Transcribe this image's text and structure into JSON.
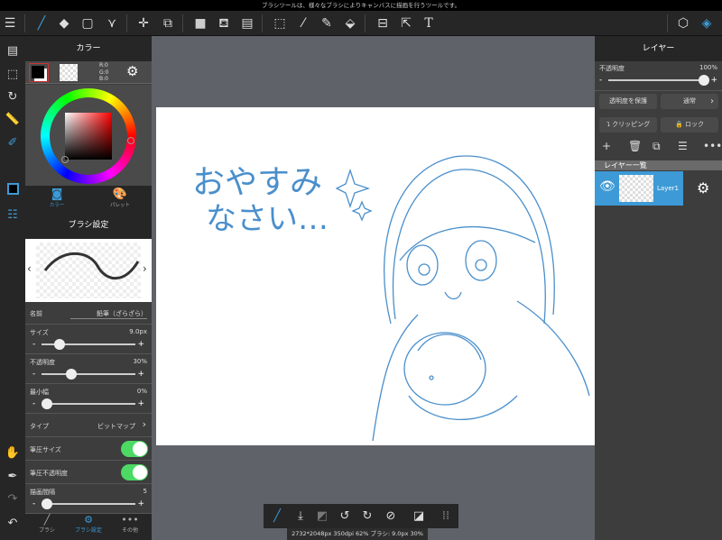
{
  "status_text": "ブラシツールは、様々なブラシによりキャンバスに描画を行うツールです。",
  "color_panel": {
    "title": "カラー",
    "r": "R:0",
    "g": "G:0",
    "b": "B:0",
    "tab_color": "カラー",
    "tab_palette": "パレット"
  },
  "brush_settings": {
    "title": "ブラシ設定",
    "name_label": "名前",
    "name_value": "鉛筆（ざらざら）",
    "size_label": "サイズ",
    "size_value": "9.0px",
    "size_fraction": 0.18,
    "opacity_label": "不透明度",
    "opacity_value": "30%",
    "opacity_fraction": 0.3,
    "min_width_label": "最小幅",
    "min_width_value": "0%",
    "min_width_fraction": 0.0,
    "type_label": "タイプ",
    "type_value": "ビットマップ",
    "pressure_size_label": "筆圧サイズ",
    "pressure_size_on": true,
    "pressure_opacity_label": "筆圧不透明度",
    "pressure_opacity_on": true,
    "spacing_label": "描画間隔",
    "spacing_value": "5",
    "spacing_fraction": 0.0,
    "minus": "-",
    "plus": "+"
  },
  "bottom_tabs": [
    "ブラシ",
    "ブラシ設定",
    "その他"
  ],
  "layer_panel": {
    "title": "レイヤー",
    "opacity_label": "不透明度",
    "opacity_value": "100%",
    "opacity_fraction": 1.0,
    "protect_alpha": "透明度を保護",
    "blend_mode": "通常",
    "clipping": "クリッピング",
    "lock": "ロック",
    "list_title": "レイヤー一覧",
    "layer_name": "Layer1"
  },
  "canvas": {
    "text_line1": "おやすみ",
    "text_line2": "なさい…",
    "sketch_color": "#4a8fcc"
  },
  "info_text": "2732*2048px 350dpi 62% ブラシ: 9.0px 30%",
  "accent": "#3d9ad6"
}
